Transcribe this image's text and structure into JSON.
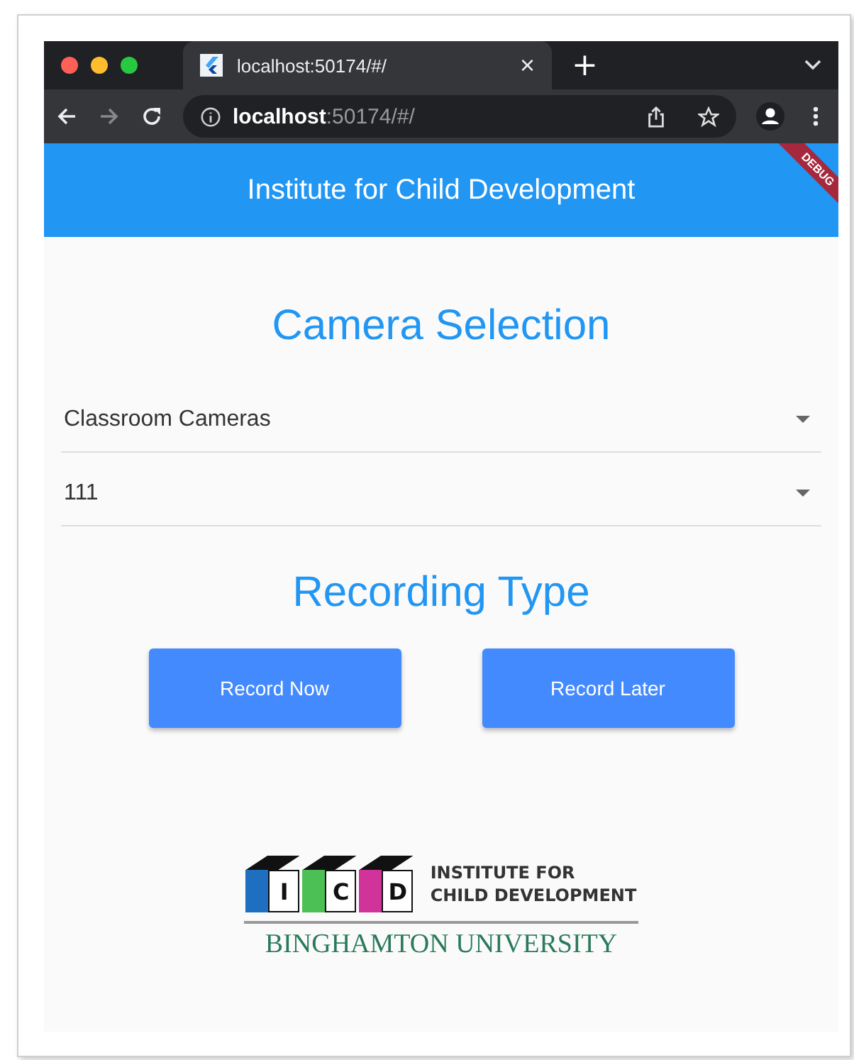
{
  "browser": {
    "tab_title": "localhost:50174/#/",
    "tab_close": "×",
    "new_tab": "+",
    "address": "**localhost**:50174/#/"
  },
  "app_bar": {
    "title": "Institute for Child Development",
    "debug_banner": "DEBUG"
  },
  "heading": "Camera Selection",
  "dropdowns": [
    {
      "value": "Classroom Cameras"
    },
    {
      "value": "111"
    }
  ],
  "subheading": "Recording Type",
  "buttons": [
    {
      "label": "Record Now"
    },
    {
      "label": "Record Later"
    }
  ],
  "logo": {
    "letters": [
      "I",
      "C",
      "D"
    ],
    "line1": "INSTITUTE FOR",
    "line2": "CHILD DEVELOPMENT",
    "university": "BINGHAMTON UNIVERSITY"
  }
}
